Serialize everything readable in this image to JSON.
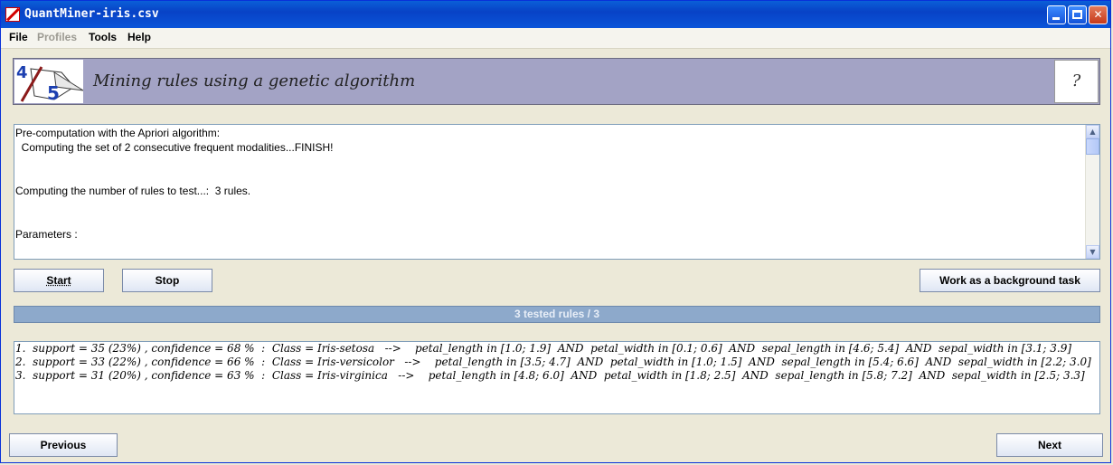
{
  "window": {
    "title": "QuantMiner-iris.csv",
    "minimize_label": "",
    "maximize_label": "",
    "close_label": "✕"
  },
  "menu": {
    "items": [
      {
        "label": "File",
        "enabled": true
      },
      {
        "label": "Profiles",
        "enabled": false
      },
      {
        "label": "Tools",
        "enabled": true
      },
      {
        "label": "Help",
        "enabled": true
      }
    ]
  },
  "banner": {
    "logo_text_top": "4",
    "logo_text_bottom": "5",
    "title": "Mining rules using a genetic algorithm",
    "help_label": "?"
  },
  "log": {
    "lines": [
      "Pre-computation with the Apriori algorithm:",
      "  Computing the set of 2 consecutive frequent modalities...FINISH!",
      "",
      "",
      "Computing the number of rules to test...:  3 rules.",
      "",
      "",
      "Parameters :"
    ]
  },
  "controls": {
    "start_label": "Start",
    "stop_label": "Stop",
    "background_label": "Work as a background task"
  },
  "progress": {
    "text": "3 tested rules /  3",
    "tested": 3,
    "total": 3
  },
  "results": {
    "rules": [
      "1.  support = 35 (23%) , confidence = 68 %  :  Class = Iris-setosa   -->    petal_length in [1.0; 1.9]  AND  petal_width in [0.1; 0.6]  AND  sepal_length in [4.6; 5.4]  AND  sepal_width in [3.1; 3.9]",
      "2.  support = 33 (22%) , confidence = 66 %  :  Class = Iris-versicolor   -->    petal_length in [3.5; 4.7]  AND  petal_width in [1.0; 1.5]  AND  sepal_length in [5.4; 6.6]  AND  sepal_width in [2.2; 3.0]",
      "3.  support = 31 (20%) , confidence = 63 %  :  Class = Iris-virginica   -->    petal_length in [4.8; 6.0]  AND  petal_width in [1.8; 2.5]  AND  sepal_length in [5.8; 7.2]  AND  sepal_width in [2.5; 3.3]"
    ]
  },
  "navigation": {
    "previous_label": "Previous",
    "next_label": "Next"
  }
}
